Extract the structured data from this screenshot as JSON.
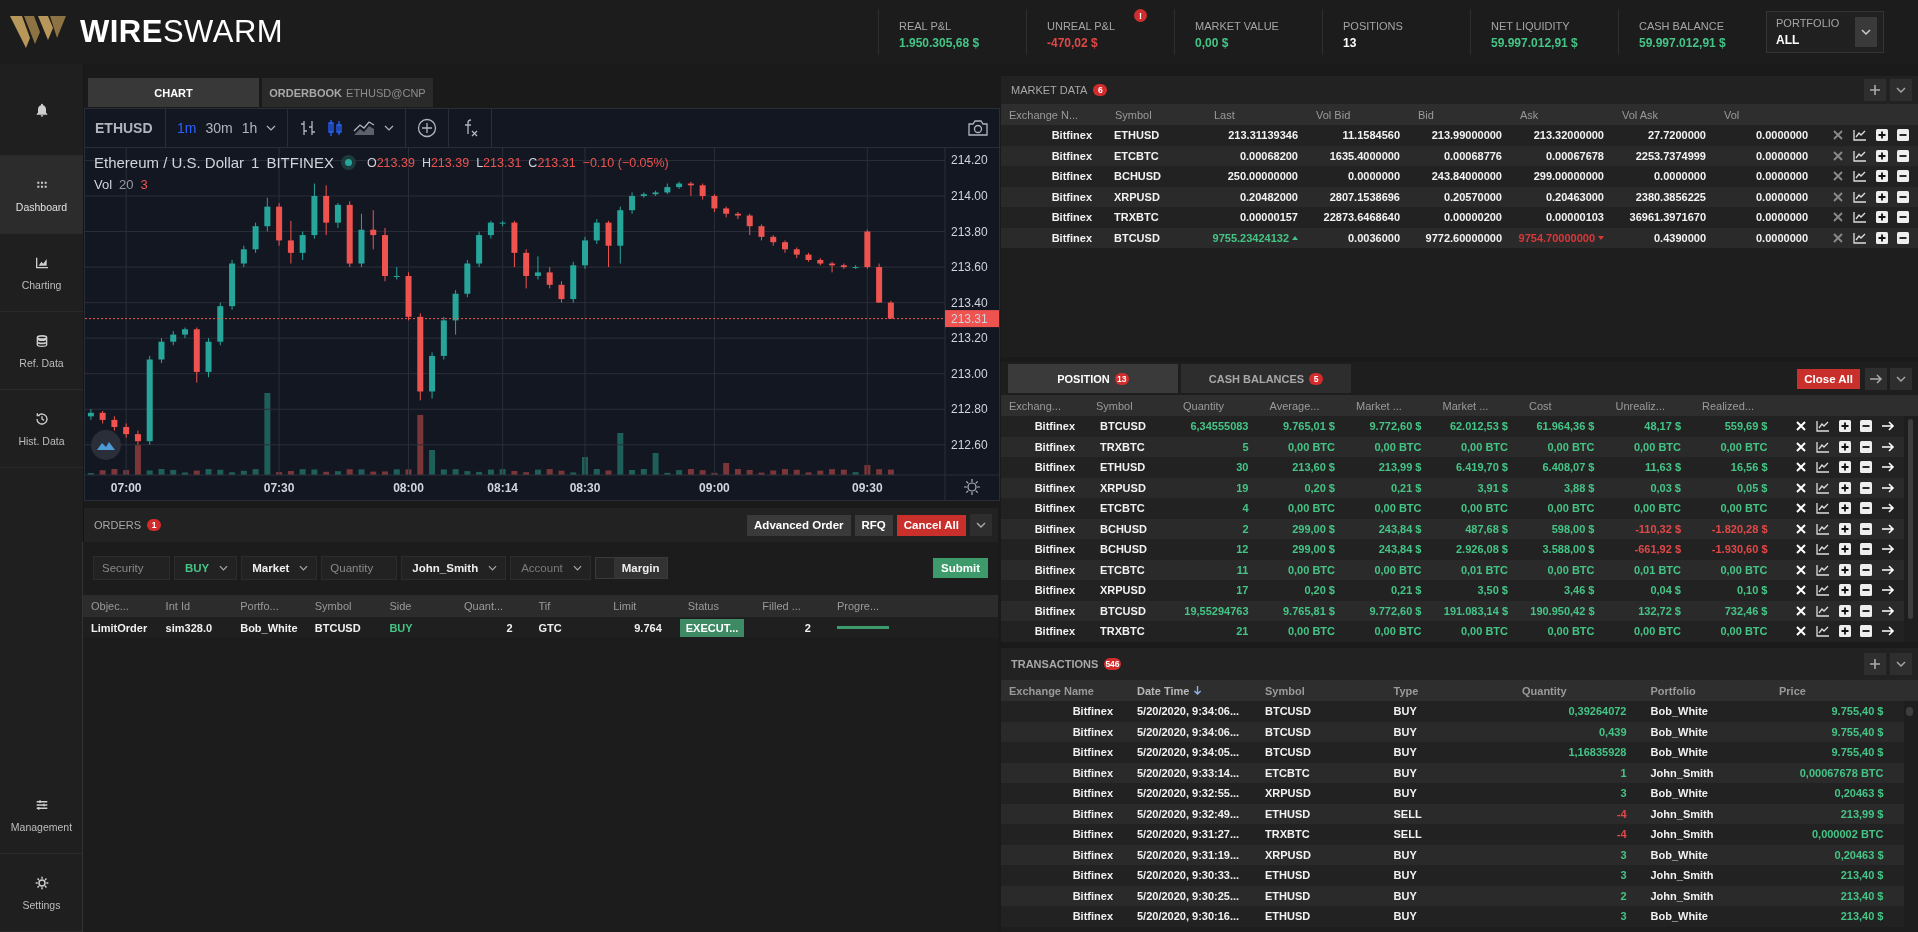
{
  "brand": {
    "name": "**WIRE**SWARM"
  },
  "header": {
    "stats": [
      {
        "label": "REAL P&L",
        "value": "1.950.305,68 $",
        "color": "#45c486"
      },
      {
        "label": "UNREAL P&L",
        "value": "-470,02 $",
        "color": "#e04848",
        "alert": "!"
      },
      {
        "label": "MARKET VALUE",
        "value": "0,00 $",
        "color": "#45c486"
      },
      {
        "label": "POSITIONS",
        "value": "13",
        "color": "#ffffff"
      },
      {
        "label": "NET LIQUIDITY",
        "value": "59.997.012,91 $",
        "color": "#45c486"
      },
      {
        "label": "CASH BALANCE",
        "value": "59.997.012,91 $",
        "color": "#45c486"
      }
    ],
    "portfolio": {
      "label": "PORTFOLIO",
      "value": "ALL"
    }
  },
  "sidebar": {
    "items": [
      {
        "label": "Dashboard",
        "selected": true
      },
      {
        "label": "Charting",
        "selected": false
      },
      {
        "label": "Ref. Data",
        "selected": false
      },
      {
        "label": "Hist. Data",
        "selected": false
      }
    ],
    "bottom_items": [
      {
        "label": "Management"
      },
      {
        "label": "Settings"
      }
    ]
  },
  "chart_panel": {
    "tabs": [
      {
        "label": "CHART",
        "selected": true
      },
      {
        "label": "ORDERBOOK",
        "sub": "ETHUSD@CNP",
        "selected": false
      }
    ],
    "toolbar": {
      "symbol": "ETHUSD",
      "intervals": [
        {
          "label": "1m",
          "selected": true
        },
        {
          "label": "30m",
          "selected": false
        },
        {
          "label": "1h",
          "selected": false
        }
      ],
      "chart_styles": [
        {
          "kind": "bars",
          "selected": false
        },
        {
          "kind": "candles",
          "selected": true
        },
        {
          "kind": "area",
          "selected": false
        }
      ]
    },
    "legend": {
      "title": "Ethereum / U.S. Dollar",
      "interval": "1",
      "exchange": "BITFINEX",
      "ohlc": [
        {
          "key": "O",
          "value": "213.39"
        },
        {
          "key": "H",
          "value": "213.39"
        },
        {
          "key": "L",
          "value": "213.31"
        },
        {
          "key": "C",
          "value": "213.31"
        }
      ],
      "change": "−0.10 (−0.05%)",
      "volume": {
        "label": "Vol",
        "period": "20",
        "value": "3"
      }
    },
    "chart_data": {
      "type": "candlestick",
      "categories": [
        null,
        null,
        null,
        "07:00",
        null,
        null,
        null,
        null,
        null,
        null,
        null,
        null,
        null,
        null,
        null,
        null,
        "07:30",
        null,
        null,
        null,
        null,
        null,
        null,
        null,
        null,
        null,
        null,
        "08:00",
        null,
        null,
        null,
        null,
        null,
        null,
        null,
        "08:14",
        null,
        null,
        null,
        null,
        null,
        null,
        "08:30",
        null,
        null,
        null,
        null,
        null,
        null,
        null,
        null,
        null,
        null,
        "09:00",
        null,
        null,
        null,
        null,
        null,
        null,
        null,
        null,
        null,
        null,
        null,
        null,
        "09:30",
        null,
        null
      ],
      "ohlc": [
        [
          212.76,
          212.8,
          212.74,
          212.78
        ],
        [
          212.78,
          212.79,
          212.72,
          212.74
        ],
        [
          212.74,
          212.76,
          212.68,
          212.7
        ],
        [
          212.7,
          212.72,
          212.64,
          212.66
        ],
        [
          212.66,
          212.68,
          212.6,
          212.62
        ],
        [
          212.62,
          213.1,
          212.6,
          213.08
        ],
        [
          213.08,
          213.2,
          213.06,
          213.18
        ],
        [
          213.18,
          213.24,
          213.16,
          213.22
        ],
        [
          213.22,
          213.26,
          213.2,
          213.25
        ],
        [
          213.25,
          213.26,
          212.95,
          213.01
        ],
        [
          213.01,
          213.2,
          212.98,
          213.18
        ],
        [
          213.18,
          213.4,
          213.16,
          213.38
        ],
        [
          213.38,
          213.64,
          213.36,
          213.62
        ],
        [
          213.62,
          213.72,
          213.6,
          213.7
        ],
        [
          213.7,
          213.85,
          213.68,
          213.83
        ],
        [
          213.83,
          213.99,
          213.8,
          213.94
        ],
        [
          213.94,
          213.96,
          213.72,
          213.75
        ],
        [
          213.75,
          213.86,
          213.62,
          213.68
        ],
        [
          213.68,
          213.8,
          213.64,
          213.78
        ],
        [
          213.78,
          214.07,
          213.76,
          214.0
        ],
        [
          214.0,
          214.06,
          213.78,
          213.85
        ],
        [
          213.85,
          213.96,
          213.82,
          213.95
        ],
        [
          213.95,
          213.97,
          213.6,
          213.62
        ],
        [
          213.62,
          213.9,
          213.6,
          213.81
        ],
        [
          213.81,
          213.92,
          213.7,
          213.78
        ],
        [
          213.78,
          213.82,
          213.52,
          213.55
        ],
        [
          213.55,
          213.6,
          213.53,
          213.55
        ],
        [
          213.55,
          213.57,
          213.3,
          213.32
        ],
        [
          213.32,
          213.34,
          212.85,
          212.9
        ],
        [
          212.9,
          213.12,
          212.86,
          213.1
        ],
        [
          213.1,
          213.32,
          213.08,
          213.3
        ],
        [
          213.3,
          213.47,
          213.22,
          213.45
        ],
        [
          213.45,
          213.64,
          213.43,
          213.62
        ],
        [
          213.62,
          213.8,
          213.6,
          213.78
        ],
        [
          213.78,
          213.86,
          213.76,
          213.85
        ],
        [
          213.85,
          213.86,
          213.83,
          213.85
        ],
        [
          213.85,
          213.86,
          213.6,
          213.68
        ],
        [
          213.68,
          213.7,
          213.48,
          213.55
        ],
        [
          213.55,
          213.66,
          213.53,
          213.57
        ],
        [
          213.57,
          213.6,
          213.48,
          213.5
        ],
        [
          213.5,
          213.52,
          213.4,
          213.42
        ],
        [
          213.42,
          213.63,
          213.4,
          213.61
        ],
        [
          213.61,
          213.77,
          213.59,
          213.75
        ],
        [
          213.75,
          213.87,
          213.73,
          213.85
        ],
        [
          213.85,
          213.86,
          213.6,
          213.72
        ],
        [
          213.72,
          213.94,
          213.62,
          213.92
        ],
        [
          213.92,
          214.02,
          213.9,
          214.0
        ],
        [
          214.0,
          214.02,
          213.99,
          214.01
        ],
        [
          214.01,
          214.03,
          214.0,
          214.02
        ],
        [
          214.02,
          214.07,
          214.01,
          214.05
        ],
        [
          214.05,
          214.08,
          214.04,
          214.07
        ],
        [
          214.07,
          214.08,
          214.0,
          214.06
        ],
        [
          214.06,
          214.07,
          213.98,
          214.0
        ],
        [
          214.0,
          214.01,
          213.91,
          213.93
        ],
        [
          213.93,
          213.94,
          213.88,
          213.9
        ],
        [
          213.9,
          213.91,
          213.87,
          213.89
        ],
        [
          213.89,
          213.9,
          213.78,
          213.83
        ],
        [
          213.83,
          213.84,
          213.75,
          213.77
        ],
        [
          213.77,
          213.78,
          213.72,
          213.74
        ],
        [
          213.74,
          213.75,
          213.68,
          213.7
        ],
        [
          213.7,
          213.71,
          213.65,
          213.67
        ],
        [
          213.67,
          213.68,
          213.63,
          213.64
        ],
        [
          213.64,
          213.65,
          213.61,
          213.62
        ],
        [
          213.62,
          213.63,
          213.57,
          213.61
        ],
        [
          213.61,
          213.62,
          213.59,
          213.6
        ],
        [
          213.6,
          213.61,
          213.59,
          213.6
        ],
        [
          213.8,
          213.81,
          213.59,
          213.6
        ],
        [
          213.6,
          213.62,
          213.4,
          213.4
        ],
        [
          213.4,
          213.41,
          213.31,
          213.31
        ]
      ],
      "ylim": [
        212.43,
        214.27
      ],
      "grid": true,
      "ref_lines": [
        {
          "axis": "y",
          "value": 213.31,
          "label": "213.31"
        }
      ],
      "yticks": [
        {
          "value": 214.2,
          "label": "214.20"
        },
        {
          "value": 214.0,
          "label": "214.00"
        },
        {
          "value": 213.8,
          "label": "213.80"
        },
        {
          "value": 213.6,
          "label": "213.60"
        },
        {
          "value": 213.4,
          "label": "213.40"
        },
        {
          "value": 213.2,
          "label": "213.20"
        },
        {
          "value": 213.0,
          "label": "213.00"
        },
        {
          "value": 212.8,
          "label": "212.80"
        },
        {
          "value": 212.6,
          "label": "212.60"
        }
      ]
    }
  },
  "orders": {
    "title": "ORDERS",
    "badge": "1",
    "buttons": [
      {
        "label": "Advanced Order",
        "kind": "default"
      },
      {
        "label": "RFQ",
        "kind": "default"
      },
      {
        "label": "Cancel All",
        "kind": "danger"
      }
    ],
    "form": [
      {
        "kind": "input",
        "placeholder": "Security"
      },
      {
        "kind": "select",
        "value": "BUY",
        "color": "#45c486"
      },
      {
        "kind": "select",
        "value": "Market",
        "color": "#eeeeee"
      },
      {
        "kind": "input",
        "placeholder": "Quantity"
      },
      {
        "kind": "select",
        "value": "John_Smith",
        "color": "#eeeeee"
      },
      {
        "kind": "select",
        "placeholder": "Account"
      },
      {
        "kind": "toggle",
        "label": "Margin",
        "on": false
      }
    ],
    "submit": "Submit",
    "columns": [
      "Objec...",
      "Int Id",
      "Portfo...",
      "Symbol",
      "Side",
      "Quant...",
      "Tif",
      "Limit",
      "Status",
      "Filled ...",
      "Progre..."
    ],
    "rows": [
      {
        "cells": [
          "LimitOrder",
          "sim328.0",
          "Bob_White",
          "BTCUSD",
          "BUY",
          "2",
          "GTC",
          "9.764",
          "EXECUT...",
          "2"
        ],
        "kind": "buy",
        "progress": {
          "level": 1
        }
      }
    ]
  },
  "market_data": {
    "title": "MARKET DATA",
    "badge": "6",
    "columns": [
      "Exchange N...",
      "Symbol",
      "Last",
      "Vol Bid",
      "Bid",
      "Ask",
      "Vol Ask",
      "Vol"
    ],
    "rows": [
      {
        "cells": [
          "Bitfinex",
          "ETHUSD",
          "213.31139346",
          "11.1584560",
          "213.99000000",
          "213.32000000",
          "27.7200000",
          "0.0000000"
        ],
        "last_up": false,
        "ask_down": false
      },
      {
        "cells": [
          "Bitfinex",
          "ETCBTC",
          "0.00068200",
          "1635.4000000",
          "0.00068776",
          "0.00067678",
          "2253.7374999",
          "0.0000000"
        ],
        "last_up": false,
        "ask_down": false
      },
      {
        "cells": [
          "Bitfinex",
          "BCHUSD",
          "250.00000000",
          "0.0000000",
          "243.84000000",
          "299.00000000",
          "0.0000000",
          "0.0000000"
        ],
        "last_up": false,
        "ask_down": false
      },
      {
        "cells": [
          "Bitfinex",
          "XRPUSD",
          "0.20482000",
          "2807.1538696",
          "0.20570000",
          "0.20463000",
          "2380.3856225",
          "0.0000000"
        ],
        "last_up": false,
        "ask_down": false
      },
      {
        "cells": [
          "Bitfinex",
          "TRXBTC",
          "0.00000157",
          "22873.6468640",
          "0.00000200",
          "0.00000103",
          "36961.3971670",
          "0.0000000"
        ],
        "last_up": false,
        "ask_down": false
      },
      {
        "cells": [
          "Bitfinex",
          "BTCUSD",
          "9755.23424132",
          "0.0036000",
          "9772.60000000",
          "9754.70000000",
          "0.4390000",
          "0.0000000"
        ],
        "last_up": true,
        "ask_down": true
      }
    ]
  },
  "positions": {
    "tabs": [
      {
        "label": "POSITION",
        "badge": "13",
        "selected": true
      },
      {
        "label": "CASH BALANCES",
        "badge": "5",
        "selected": false
      }
    ],
    "close_all": "Close All",
    "columns": [
      "Exchang...",
      "Symbol",
      "Quantity",
      "Average...",
      "Market ...",
      "Market ...",
      "Cost",
      "Unrealiz...",
      "Realized..."
    ],
    "rows": [
      {
        "cells": [
          "Bitfinex",
          "BTCUSD",
          "6,34555083",
          "9.765,01 $",
          "9.772,60 $",
          "62.012,53 $",
          "61.964,36 $",
          "48,17 $",
          "559,69 $"
        ],
        "loss": false
      },
      {
        "cells": [
          "Bitfinex",
          "TRXBTC",
          "5",
          "0,00 BTC",
          "0,00 BTC",
          "0,00 BTC",
          "0,00 BTC",
          "0,00 BTC",
          "0,00 BTC"
        ],
        "loss": false
      },
      {
        "cells": [
          "Bitfinex",
          "ETHUSD",
          "30",
          "213,60 $",
          "213,99 $",
          "6.419,70 $",
          "6.408,07 $",
          "11,63 $",
          "16,56 $"
        ],
        "loss": false
      },
      {
        "cells": [
          "Bitfinex",
          "XRPUSD",
          "19",
          "0,20 $",
          "0,21 $",
          "3,91 $",
          "3,88 $",
          "0,03 $",
          "0,05 $"
        ],
        "loss": false
      },
      {
        "cells": [
          "Bitfinex",
          "ETCBTC",
          "4",
          "0,00 BTC",
          "0,00 BTC",
          "0,00 BTC",
          "0,00 BTC",
          "0,00 BTC",
          "0,00 BTC"
        ],
        "loss": false
      },
      {
        "cells": [
          "Bitfinex",
          "BCHUSD",
          "2",
          "299,00 $",
          "243,84 $",
          "487,68 $",
          "598,00 $",
          "-110,32 $",
          "-1.820,28 $"
        ],
        "loss": true
      },
      {
        "cells": [
          "Bitfinex",
          "BCHUSD",
          "12",
          "299,00 $",
          "243,84 $",
          "2.926,08 $",
          "3.588,00 $",
          "-661,92 $",
          "-1.930,60 $"
        ],
        "loss": true
      },
      {
        "cells": [
          "Bitfinex",
          "ETCBTC",
          "11",
          "0,00 BTC",
          "0,00 BTC",
          "0,01 BTC",
          "0,00 BTC",
          "0,01 BTC",
          "0,00 BTC"
        ],
        "loss": false
      },
      {
        "cells": [
          "Bitfinex",
          "XRPUSD",
          "17",
          "0,20 $",
          "0,21 $",
          "3,50 $",
          "3,46 $",
          "0,04 $",
          "0,10 $"
        ],
        "loss": false
      },
      {
        "cells": [
          "Bitfinex",
          "BTCUSD",
          "19,55294763",
          "9.765,81 $",
          "9.772,60 $",
          "191.083,14 $",
          "190.950,42 $",
          "132,72 $",
          "732,46 $"
        ],
        "loss": false
      },
      {
        "cells": [
          "Bitfinex",
          "TRXBTC",
          "21",
          "0,00 BTC",
          "0,00 BTC",
          "0,00 BTC",
          "0,00 BTC",
          "0,00 BTC",
          "0,00 BTC"
        ],
        "loss": false
      }
    ]
  },
  "transactions": {
    "title": "TRANSACTIONS",
    "badge": "546",
    "columns": [
      {
        "label": "Exchange Name",
        "sorted": false
      },
      {
        "label": "Date Time",
        "sorted": true
      },
      {
        "label": "Symbol",
        "sorted": false
      },
      {
        "label": "Type",
        "sorted": false
      },
      {
        "label": "Quantity",
        "sorted": false
      },
      {
        "label": "Portfolio",
        "sorted": false
      },
      {
        "label": "Price",
        "sorted": false
      }
    ],
    "rows": [
      {
        "cells": [
          "Bitfinex",
          "5/20/2020, 9:34:06...",
          "BTCUSD",
          "BUY",
          "0,39264072",
          "Bob_White",
          "9.755,40 $"
        ],
        "negative": false
      },
      {
        "cells": [
          "Bitfinex",
          "5/20/2020, 9:34:06...",
          "BTCUSD",
          "BUY",
          "0,439",
          "Bob_White",
          "9.755,40 $"
        ],
        "negative": false
      },
      {
        "cells": [
          "Bitfinex",
          "5/20/2020, 9:34:05...",
          "BTCUSD",
          "BUY",
          "1,16835928",
          "Bob_White",
          "9.755,40 $"
        ],
        "negative": false
      },
      {
        "cells": [
          "Bitfinex",
          "5/20/2020, 9:33:14...",
          "ETCBTC",
          "BUY",
          "1",
          "John_Smith",
          "0,00067678 BTC"
        ],
        "negative": false
      },
      {
        "cells": [
          "Bitfinex",
          "5/20/2020, 9:32:55...",
          "XRPUSD",
          "BUY",
          "3",
          "Bob_White",
          "0,20463 $"
        ],
        "negative": false
      },
      {
        "cells": [
          "Bitfinex",
          "5/20/2020, 9:32:49...",
          "ETHUSD",
          "SELL",
          "-4",
          "John_Smith",
          "213,99 $"
        ],
        "negative": true
      },
      {
        "cells": [
          "Bitfinex",
          "5/20/2020, 9:31:27...",
          "TRXBTC",
          "SELL",
          "-4",
          "John_Smith",
          "0,000002 BTC"
        ],
        "negative": true
      },
      {
        "cells": [
          "Bitfinex",
          "5/20/2020, 9:31:19...",
          "XRPUSD",
          "BUY",
          "3",
          "Bob_White",
          "0,20463 $"
        ],
        "negative": false
      },
      {
        "cells": [
          "Bitfinex",
          "5/20/2020, 9:30:33...",
          "ETHUSD",
          "BUY",
          "3",
          "John_Smith",
          "213,40 $"
        ],
        "negative": false
      },
      {
        "cells": [
          "Bitfinex",
          "5/20/2020, 9:30:25...",
          "ETHUSD",
          "BUY",
          "2",
          "John_Smith",
          "213,40 $"
        ],
        "negative": false
      },
      {
        "cells": [
          "Bitfinex",
          "5/20/2020, 9:30:16...",
          "ETHUSD",
          "BUY",
          "3",
          "Bob_White",
          "213,40 $"
        ],
        "negative": false
      }
    ]
  }
}
